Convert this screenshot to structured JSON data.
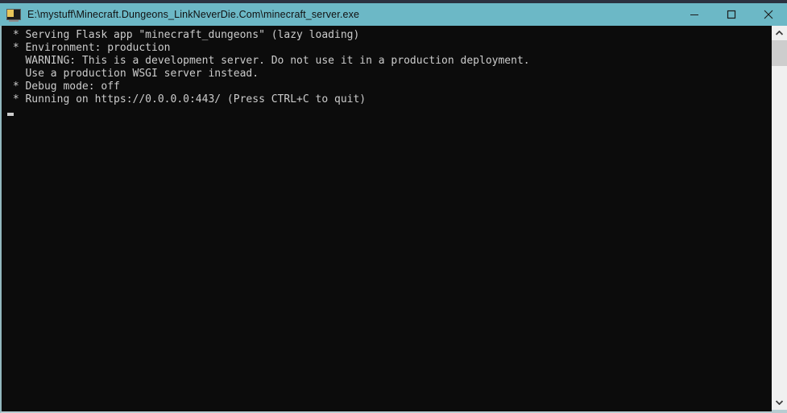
{
  "window": {
    "title": "E:\\mystuff\\Minecraft.Dungeons_LinkNeverDie.Com\\minecraft_server.exe",
    "icon": "console-app-icon",
    "titlebar_color": "#6cb8c6",
    "background_color": "#0c0c0c",
    "text_color": "#cccccc",
    "controls": {
      "minimize_label": "Minimize",
      "maximize_label": "Maximize",
      "close_label": "Close"
    }
  },
  "console": {
    "lines": [
      " * Serving Flask app \"minecraft_dungeons\" (lazy loading)",
      " * Environment: production",
      "   WARNING: This is a development server. Do not use it in a production deployment.",
      "   Use a production WSGI server instead.",
      " * Debug mode: off",
      " * Running on https://0.0.0.0:443/ (Press CTRL+C to quit)"
    ],
    "cursor_visible": true
  },
  "scrollbar": {
    "up_arrow": "chevron-up-icon",
    "down_arrow": "chevron-down-icon",
    "thumb_position_percent": 0,
    "track_color": "#f0f0f0",
    "thumb_color": "#cdcdcd"
  }
}
